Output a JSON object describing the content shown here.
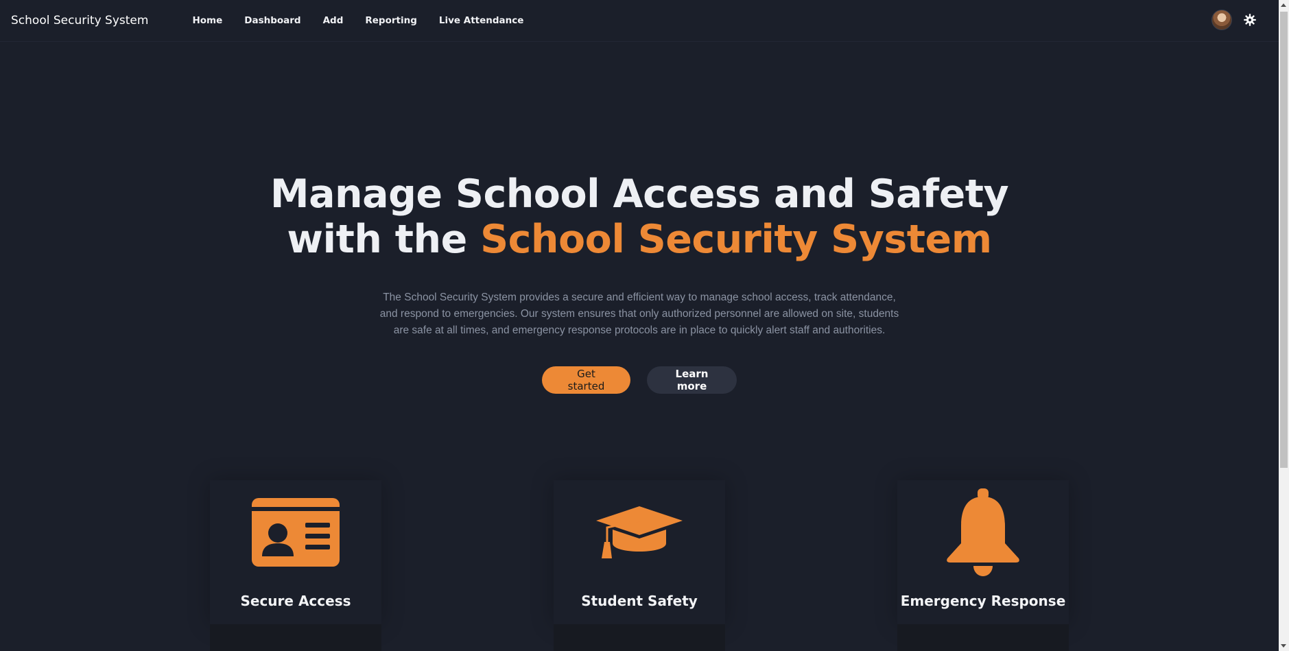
{
  "navbar": {
    "brand": "School Security System",
    "links": [
      "Home",
      "Dashboard",
      "Add",
      "Reporting",
      "Live Attendance"
    ],
    "avatar_icon": "user-avatar",
    "settings_icon": "gear-icon"
  },
  "hero": {
    "title_line1": "Manage School Access and Safety",
    "title_line2_prefix": "with the ",
    "title_line2_accent": "School Security System",
    "description": "The School Security System provides a secure and efficient way to manage school access, track attendance, and respond to emergencies. Our system ensures that only authorized personnel are allowed on site, students are safe at all times, and emergency response protocols are in place to quickly alert staff and authorities.",
    "primary_button": "Get started",
    "secondary_button": "Learn more"
  },
  "features": [
    {
      "title": "Secure Access",
      "icon": "id-card-icon"
    },
    {
      "title": "Student Safety",
      "icon": "graduation-cap-icon"
    },
    {
      "title": "Emergency Response",
      "icon": "bell-icon"
    }
  ],
  "colors": {
    "background": "#1b1f2a",
    "accent": "#ed8936",
    "text": "#eef0f4",
    "muted_text": "#8b93a3",
    "secondary_button": "#2d3240"
  }
}
